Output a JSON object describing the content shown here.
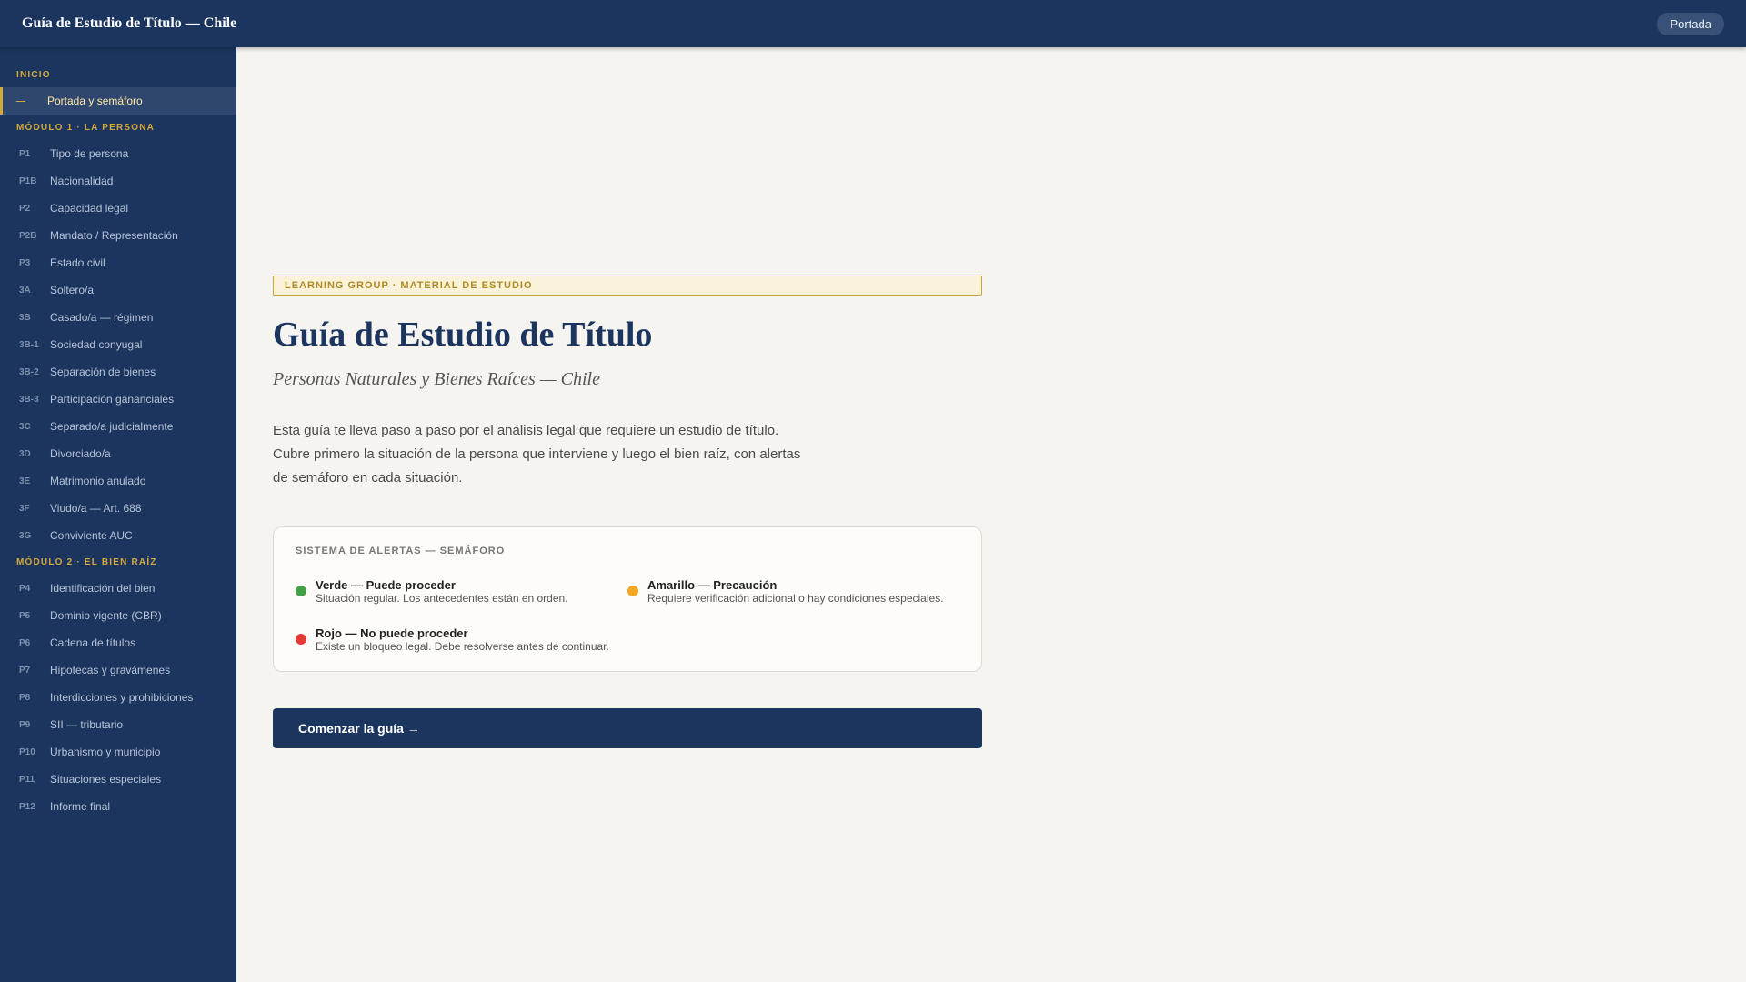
{
  "header": {
    "title": "Guía de Estudio de Título — Chile",
    "pill_label": "Portada"
  },
  "sidebar": {
    "sections": [
      {
        "label": "INICIO",
        "items": [
          {
            "code": "—",
            "label": "Portada y semáforo",
            "active": true
          }
        ]
      },
      {
        "label": "MÓDULO 1 · LA PERSONA",
        "items": [
          {
            "code": "P1",
            "label": "Tipo de persona"
          },
          {
            "code": "P1B",
            "label": "Nacionalidad"
          },
          {
            "code": "P2",
            "label": "Capacidad legal"
          },
          {
            "code": "P2B",
            "label": "Mandato / Representación"
          },
          {
            "code": "P3",
            "label": "Estado civil"
          },
          {
            "code": "3A",
            "label": "Soltero/a"
          },
          {
            "code": "3B",
            "label": "Casado/a — régimen"
          },
          {
            "code": "3B-1",
            "label": "Sociedad conyugal"
          },
          {
            "code": "3B-2",
            "label": "Separación de bienes"
          },
          {
            "code": "3B-3",
            "label": "Participación gananciales"
          },
          {
            "code": "3C",
            "label": "Separado/a judicialmente"
          },
          {
            "code": "3D",
            "label": "Divorciado/a"
          },
          {
            "code": "3E",
            "label": "Matrimonio anulado"
          },
          {
            "code": "3F",
            "label": "Viudo/a — Art. 688"
          },
          {
            "code": "3G",
            "label": "Conviviente AUC"
          }
        ]
      },
      {
        "label": "MÓDULO 2 · EL BIEN RAÍZ",
        "items": [
          {
            "code": "P4",
            "label": "Identificación del bien"
          },
          {
            "code": "P5",
            "label": "Dominio vigente (CBR)"
          },
          {
            "code": "P6",
            "label": "Cadena de títulos"
          },
          {
            "code": "P7",
            "label": "Hipotecas y gravámenes"
          },
          {
            "code": "P8",
            "label": "Interdicciones y prohibiciones"
          },
          {
            "code": "P9",
            "label": "SII — tributario"
          },
          {
            "code": "P10",
            "label": "Urbanismo y municipio"
          },
          {
            "code": "P11",
            "label": "Situaciones especiales"
          },
          {
            "code": "P12",
            "label": "Informe final"
          }
        ]
      }
    ]
  },
  "main": {
    "tag": "LEARNING GROUP · MATERIAL DE ESTUDIO",
    "title": "Guía de Estudio de Título",
    "subtitle": "Personas Naturales y Bienes Raíces — Chile",
    "intro_lines": [
      "Esta guía te lleva paso a paso por el análisis legal que requiere un estudio de título.",
      "Cubre primero la situación de la persona que interviene y luego el bien raíz, con alertas",
      "de semáforo en cada situación."
    ],
    "alerts": {
      "title": "SISTEMA DE ALERTAS — SEMÁFORO",
      "items": [
        {
          "name": "Verde — Puede proceder",
          "desc": "Situación regular. Los antecedentes están en orden.",
          "color": "#43a047"
        },
        {
          "name": "Amarillo — Precaución",
          "desc": "Requiere verificación adicional o hay condiciones especiales.",
          "color": "#f5a623"
        },
        {
          "name": "Rojo — No puede proceder",
          "desc": "Existe un bloqueo legal. Debe resolverse antes de continuar.",
          "color": "#e53935"
        }
      ]
    },
    "start_button": "Comenzar la guía →"
  }
}
